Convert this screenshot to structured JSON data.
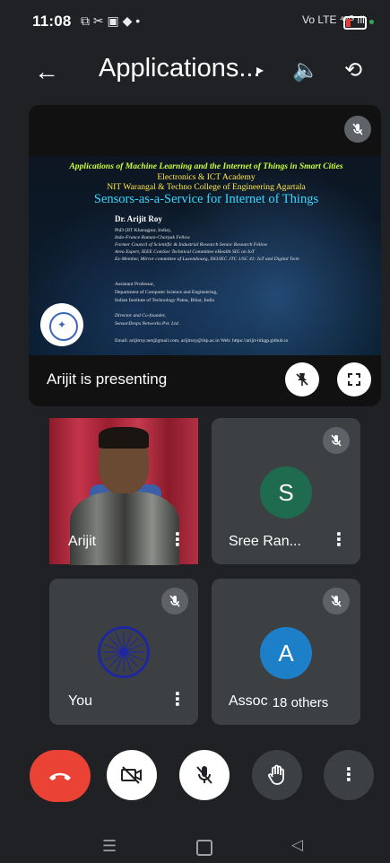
{
  "status_bar": {
    "time": "11:08",
    "left_icons": "⧉ ✂ ▣ ◆ •",
    "right_icons": "Vo LTE ⁴⁶ᴳ ıll"
  },
  "header": {
    "back_icon": "←",
    "title": "Applications...",
    "caret": "▸",
    "speaker_icon": "🔈",
    "camera_flip_icon": "⟲"
  },
  "presentation": {
    "mute_icon": "🎙̸",
    "slide": {
      "line1": "Applications of Machine Learning and the Internet of Things in Smart Cities",
      "line2": "Electronics & ICT Academy",
      "line3": "NIT Warangal & Techno College of Engineering Agartala",
      "line4": "Sensors-as-a-Service for Internet of Things",
      "name": "Dr. Arijit Roy",
      "details": [
        "PhD (IIT Kharagpur, India),",
        "Indo-France Raman-Charpak Fellow",
        "Former Council of Scientific & Industrial Research Senior Research Fellow",
        "Area Expert, IEEE ComSoc Technical Committee eHealth SIG on IoT",
        "Ex-Member, Mirror committee of Luxembourg, ISO/IEC JTC 1/SC 41: IoT and Digital Twin",
        "Assistant Professor,",
        "Department of Computer Science and Engineering,",
        "Indian Institute of Technology Patna, Bihar, India",
        "Director and Co-founder,",
        "SensorDrops Networks Pvt. Ltd."
      ],
      "email": "Email: arijitroy.net@gmail.com, arijitroy@iitp.ac.in Web: https://arijit-iitkgp.github.io"
    },
    "presenting_label": "Arijit is presenting",
    "unpin_icon": "📌",
    "fullscreen_icon": "⛶"
  },
  "tiles": [
    {
      "label": "Arijit",
      "muted": false
    },
    {
      "label": "Sree Ran...",
      "avatar": "S",
      "muted": true
    },
    {
      "label": "You",
      "muted": true
    },
    {
      "label": "Assoc...",
      "avatar": "A",
      "muted": true,
      "others": "18 others"
    }
  ],
  "controls": {
    "end_icon": "☎",
    "camera_off_icon": "⊘",
    "mic_off_icon": "🎙̸",
    "hand_icon": "✋",
    "more_icon": "⋮"
  },
  "nav": {
    "menu_icon": "☰",
    "back_icon": "◁"
  },
  "colors": {
    "end_call": "#ea4335",
    "tile_bg": "#3c4043",
    "avatar_s": "#1e6b4f",
    "avatar_a": "#1c7fc7"
  }
}
